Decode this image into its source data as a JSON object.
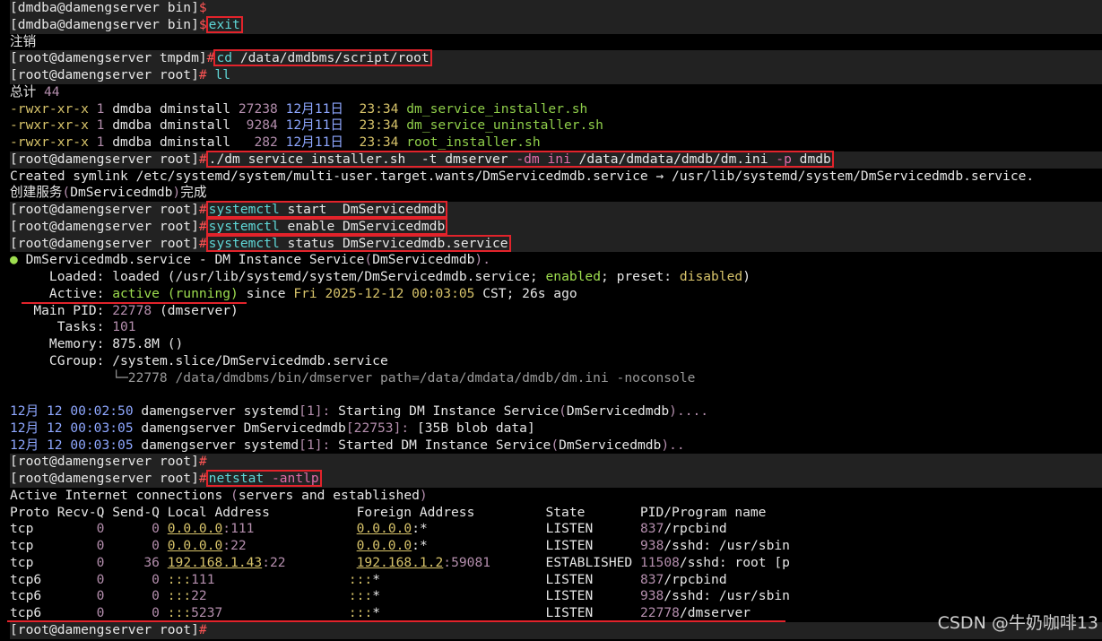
{
  "l1": {
    "prompt": "[dmdba@damengserver bin]",
    "sym": "$"
  },
  "l2": {
    "prompt": "[dmdba@damengserver bin]",
    "sym": "$",
    "cmd": "exit"
  },
  "l3": "注销",
  "l4": {
    "prompt": "[root@damengserver tmpdm]",
    "sym": "#",
    "cmd1": "cd",
    "cmd2": " /data/dmdbms/script/root"
  },
  "l5": {
    "prompt": "[root@damengserver root]",
    "sym": "#",
    "cmd": "ll"
  },
  "l6": {
    "a": "总计",
    "b": "44"
  },
  "files": [
    {
      "perm": "-rwxr-xr-x",
      "links": "1",
      "user": "dmdba",
      "group": "dminstall",
      "size": "27238",
      "month": "12月",
      "day": "11日",
      "time": "23:34",
      "name": "dm_service_installer.sh"
    },
    {
      "perm": "-rwxr-xr-x",
      "links": "1",
      "user": "dmdba",
      "group": "dminstall",
      "size": " 9284",
      "month": "12月",
      "day": "11日",
      "time": "23:34",
      "name": "dm_service_uninstaller.sh"
    },
    {
      "perm": "-rwxr-xr-x",
      "links": "1",
      "user": "dmdba",
      "group": "dminstall",
      "size": "  282",
      "month": "12月",
      "day": "11日",
      "time": "23:34",
      "name": "root_installer.sh"
    }
  ],
  "l10": {
    "prompt": "[root@damengserver root]",
    "sym": "#",
    "c1": "./dm_service_installer.sh",
    "c2": "  -t ",
    "c3": "dmserver",
    "c4": " -dm_ini ",
    "c5": "/data/dmdata/dmdb/dm.ini",
    "c6": " -p ",
    "c7": "dmdb"
  },
  "l11": {
    "a": "Created symlink /etc/systemd/system/multi-user.target.wants/DmServicedmdb.service → /usr/lib/systemd/system/DmServicedmdb.service."
  },
  "l12": {
    "a": "创建服务",
    "b": "(",
    "c": "DmServicedmdb",
    "d": ")",
    "e": "完成"
  },
  "l13": {
    "prompt": "[root@damengserver root]",
    "sym": "#",
    "c1": "systemctl",
    "c2": " start  DmServicedmdb"
  },
  "l14": {
    "prompt": "[root@damengserver root]",
    "sym": "#",
    "c1": "systemctl",
    "c2": " enable DmServicedmdb"
  },
  "l15": {
    "prompt": "[root@damengserver root]",
    "sym": "#",
    "c1": "systemctl",
    "c2": " status DmServicedmdb.service"
  },
  "l16": {
    "dot": "●",
    "a": " DmServicedmdb.service - DM Instance Service",
    "b": "(",
    "c": "DmServicedmdb",
    "d": ")."
  },
  "l17": {
    "label": "     Loaded: ",
    "a": "loaded (",
    "b": "/usr/lib/systemd/system/DmServicedmdb.service",
    "c": "; ",
    "d": "enabled",
    "e": "; preset: ",
    "f": "disabled",
    "g": ")"
  },
  "l18": {
    "label": "     Active: ",
    "a": "active (running)",
    "b": " since ",
    "c": "Fri 2025-12-12 00:03:05",
    "d": " CST; 26s ago"
  },
  "l19": {
    "label": "   Main PID: ",
    "a": "22778",
    "b": " (",
    "c": "dmserver",
    "d": ")"
  },
  "l20": {
    "label": "      Tasks: ",
    "a": "101"
  },
  "l21": {
    "label": "     Memory: ",
    "a": "875.8M",
    "b": " ()"
  },
  "l22": {
    "label": "     CGroup: ",
    "a": "/system.slice/DmServicedmdb.service"
  },
  "l23": {
    "a": "             └─22778 /data/dmdbms/bin/dmserver path=/data/dmdata/dmdb/dm.ini -noconsole"
  },
  "l25": {
    "m": "12月",
    "d": " 12 00:02:50",
    "h": " damengserver ",
    "s": "systemd",
    "b1": "[",
    "pid": "1",
    "b2": "]:",
    "t": " Starting DM Instance Service",
    "p1": "(",
    "n": "DmServicedmdb",
    "p2": ")...."
  },
  "l26": {
    "m": "12月",
    "d": " 12 00:03:05",
    "h": " damengserver ",
    "s": "DmServicedmdb",
    "b1": "[",
    "pid": "22753",
    "b2": "]:",
    "t": " [35B blob data]"
  },
  "l27": {
    "m": "12月",
    "d": " 12 00:03:05",
    "h": " damengserver ",
    "s": "systemd",
    "b1": "[",
    "pid": "1",
    "b2": "]:",
    "t": " Started DM Instance Service",
    "p1": "(",
    "n": "DmServicedmdb",
    "p2": ").."
  },
  "l28": {
    "prompt": "[root@damengserver root]",
    "sym": "#"
  },
  "l29": {
    "prompt": "[root@damengserver root]",
    "sym": "#",
    "c1": "netstat",
    "c2": " -antlp"
  },
  "l30": {
    "a": "Active Internet connections ",
    "b": "(",
    "c": "servers and established",
    "d": ")"
  },
  "l31": {
    "a": "Proto Recv-Q Send-Q Local Address           Foreign Address         State       PID/Program name"
  },
  "conns": [
    {
      "proto": "tcp  ",
      "recv": "      0",
      "send": "      0",
      "local": "0.0.0.0",
      "lport": ":111",
      "foreign": "0.0.0.0",
      "fport": ":*",
      "state": "LISTEN     ",
      "pid": "837",
      "prog": "/rpcbind"
    },
    {
      "proto": "tcp  ",
      "recv": "      0",
      "send": "      0",
      "local": "0.0.0.0",
      "lport": ":22",
      "foreign": "0.0.0.0",
      "fport": ":*",
      "state": "LISTEN     ",
      "pid": "938",
      "prog": "/sshd: /usr/sbin"
    },
    {
      "proto": "tcp  ",
      "recv": "      0",
      "send": "     36",
      "local": "192.168.1.43",
      "lport": ":22",
      "foreign": "192.168.1.2",
      "fport": ":59081",
      "state": "ESTABLISHED",
      "pid": "11508",
      "prog": "/sshd: root [p"
    },
    {
      "proto": "tcp6 ",
      "recv": "      0",
      "send": "      0",
      "local": ":::",
      "lport": "111",
      "foreign": ":::",
      "fport": "*",
      "state": "LISTEN     ",
      "pid": "837",
      "prog": "/rpcbind"
    },
    {
      "proto": "tcp6 ",
      "recv": "      0",
      "send": "      0",
      "local": ":::",
      "lport": "22",
      "foreign": ":::",
      "fport": "*",
      "state": "LISTEN     ",
      "pid": "938",
      "prog": "/sshd: /usr/sbin"
    },
    {
      "proto": "tcp6 ",
      "recv": "      0",
      "send": "      0",
      "local": ":::",
      "lport": "5237",
      "foreign": ":::",
      "fport": "*",
      "state": "LISTEN     ",
      "pid": "22778",
      "prog": "/dmserver"
    }
  ],
  "l38": {
    "prompt": "[root@damengserver root]",
    "sym": "#"
  },
  "watermark": "CSDN @牛奶咖啡13",
  "colors": {
    "box_red": "#e2232b",
    "prompt_hash": "#ff5555",
    "cyan": "#5fd7d7",
    "purple": "#b48ead",
    "green": "#8fce4a"
  }
}
